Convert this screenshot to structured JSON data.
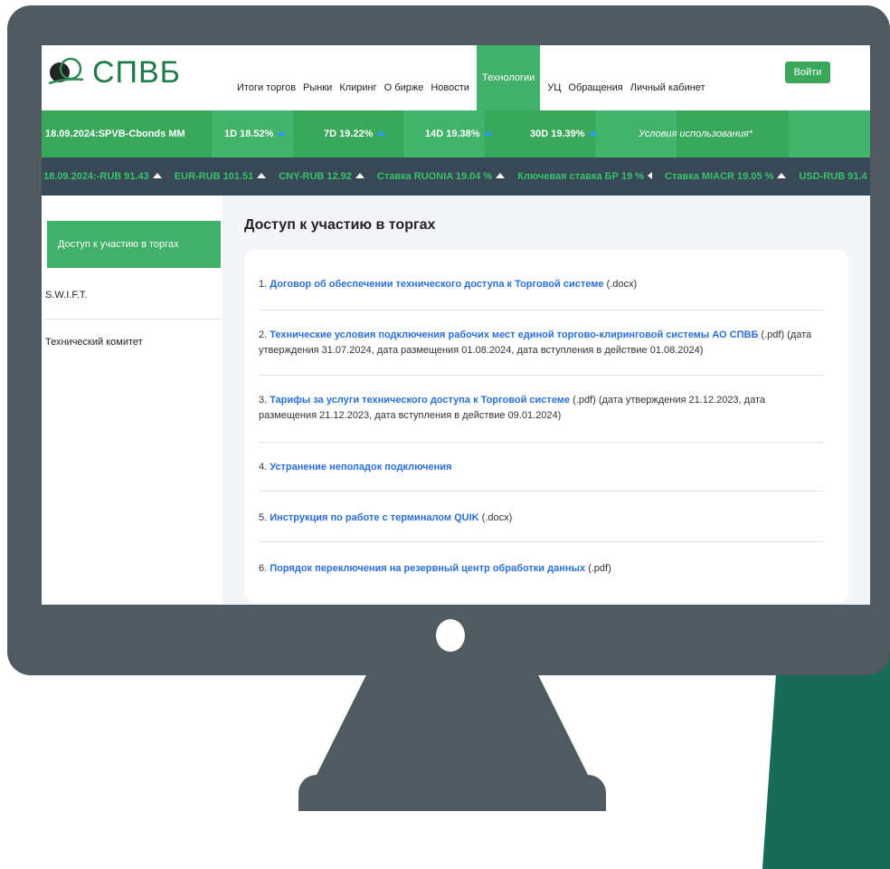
{
  "brand": {
    "logo_text": "СПВБ",
    "accent": "#41b06a",
    "dark": "#394856",
    "link": "#2a6fd6"
  },
  "nav": {
    "items": [
      "Итоги торгов",
      "Рынки",
      "Клиринг",
      "О бирже",
      "Новости",
      "Технологии",
      "УЦ",
      "Обращения",
      "Личный кабинет"
    ],
    "active": "Технологии",
    "login": "Войти"
  },
  "ticker_green": {
    "index": "18.09.2024:SPVB-Cbonds MM",
    "d1": "1D 18.52%",
    "d7": "7D 19.22%",
    "d14": "14D 19.38%",
    "d30": "30D 19.39%",
    "terms": "Условия использования*"
  },
  "ticker_dark": [
    {
      "text": "18.09.2024:-RUB 91.43",
      "icon": "up-arrow-icon"
    },
    {
      "text": "EUR-RUB 101.51",
      "icon": "up-arrow-icon"
    },
    {
      "text": "CNY-RUB 12.92",
      "icon": "up-arrow-icon"
    },
    {
      "text": "Ставка RUONIA 19.04 %",
      "icon": "up-arrow-icon"
    },
    {
      "text": "Ключевая ставка БР 19 %",
      "icon": "left-arrow-icon"
    },
    {
      "text": "Ставка MIACR 19.05 %",
      "icon": "up-arrow-icon"
    },
    {
      "text": "USD-RUB 91.4",
      "icon": ""
    }
  ],
  "sidebar": {
    "items": [
      {
        "label": "Доступ к участию в торгах",
        "active": true
      },
      {
        "label": "S.W.I.F.T.",
        "active": false
      },
      {
        "label": "Технический комитет",
        "active": false
      }
    ]
  },
  "main": {
    "title": "Доступ к участию в торгах",
    "documents": [
      {
        "num": "1. ",
        "link": "Договор об обеспечении технического доступа к Торговой системе",
        "tail": " (.docx)"
      },
      {
        "num": "2. ",
        "link": "Технические условия подключения рабочих мест единой торгово-клиринговой системы АО СПВБ",
        "tail": " (.pdf) (дата утверждения 31.07.2024, дата размещения 01.08.2024, дата вступления в действие 01.08.2024)"
      },
      {
        "num": "3. ",
        "link": "Тарифы за услуги технического доступа к Торговой системе",
        "tail": " (.pdf) (дата утверждения 21.12.2023, дата размещения 21.12.2023, дата вступления в действие 09.01.2024)"
      },
      {
        "num": "4. ",
        "link": "Устранение неполадок подключения",
        "tail": ""
      },
      {
        "num": "5. ",
        "link": "Инструкция по работе с терминалом QUIK",
        "tail": " (.docx)"
      },
      {
        "num": "6. ",
        "link": "Порядок переключения на резервный центр обработки данных",
        "tail": " (.pdf)"
      }
    ]
  }
}
